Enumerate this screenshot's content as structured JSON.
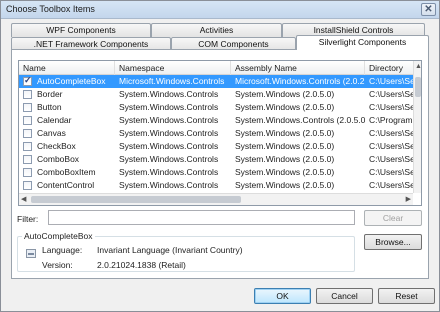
{
  "window": {
    "title": "Choose Toolbox Items",
    "close_glyph": "✕"
  },
  "tabs_row1": [
    {
      "label": "WPF Components"
    },
    {
      "label": "Activities"
    },
    {
      "label": "InstallShield Controls"
    }
  ],
  "tabs_row2": [
    {
      "label": ".NET Framework Components"
    },
    {
      "label": "COM Components"
    },
    {
      "label": "Silverlight Components"
    }
  ],
  "active_tab": "Silverlight Components",
  "grid": {
    "columns": [
      "Name",
      "Namespace",
      "Assembly Name",
      "Directory"
    ],
    "rows": [
      {
        "checked": true,
        "name": "AutoCompleteBox",
        "namespace": "Microsoft.Windows.Controls",
        "assembly": "Microsoft.Windows.Controls (2.0.2...",
        "directory": "C:\\Users\\Se..."
      },
      {
        "checked": false,
        "name": "Border",
        "namespace": "System.Windows.Controls",
        "assembly": "System.Windows (2.0.5.0)",
        "directory": "C:\\Users\\Se..."
      },
      {
        "checked": false,
        "name": "Button",
        "namespace": "System.Windows.Controls",
        "assembly": "System.Windows (2.0.5.0)",
        "directory": "C:\\Users\\Se..."
      },
      {
        "checked": false,
        "name": "Calendar",
        "namespace": "System.Windows.Controls",
        "assembly": "System.Windows.Controls (2.0.5.0)",
        "directory": "C:\\Program..."
      },
      {
        "checked": false,
        "name": "Canvas",
        "namespace": "System.Windows.Controls",
        "assembly": "System.Windows (2.0.5.0)",
        "directory": "C:\\Users\\Se..."
      },
      {
        "checked": false,
        "name": "CheckBox",
        "namespace": "System.Windows.Controls",
        "assembly": "System.Windows (2.0.5.0)",
        "directory": "C:\\Users\\Se..."
      },
      {
        "checked": false,
        "name": "ComboBox",
        "namespace": "System.Windows.Controls",
        "assembly": "System.Windows (2.0.5.0)",
        "directory": "C:\\Users\\Se..."
      },
      {
        "checked": false,
        "name": "ComboBoxItem",
        "namespace": "System.Windows.Controls",
        "assembly": "System.Windows (2.0.5.0)",
        "directory": "C:\\Users\\Se..."
      },
      {
        "checked": false,
        "name": "ContentControl",
        "namespace": "System.Windows.Controls",
        "assembly": "System.Windows (2.0.5.0)",
        "directory": "C:\\Users\\Se..."
      }
    ]
  },
  "filter": {
    "label": "Filter:",
    "value": "",
    "clear_label": "Clear"
  },
  "info": {
    "group_title": "AutoCompleteBox",
    "language_label": "Language:",
    "language_value": "Invariant Language (Invariant Country)",
    "version_label": "Version:",
    "version_value": "2.0.21024.1838 (Retail)",
    "browse_label": "Browse..."
  },
  "buttons": {
    "ok": "OK",
    "cancel": "Cancel",
    "reset": "Reset"
  },
  "colors": {
    "selection": "#3399ff",
    "panel": "#ffffff",
    "dialog": "#f0f0f0"
  }
}
